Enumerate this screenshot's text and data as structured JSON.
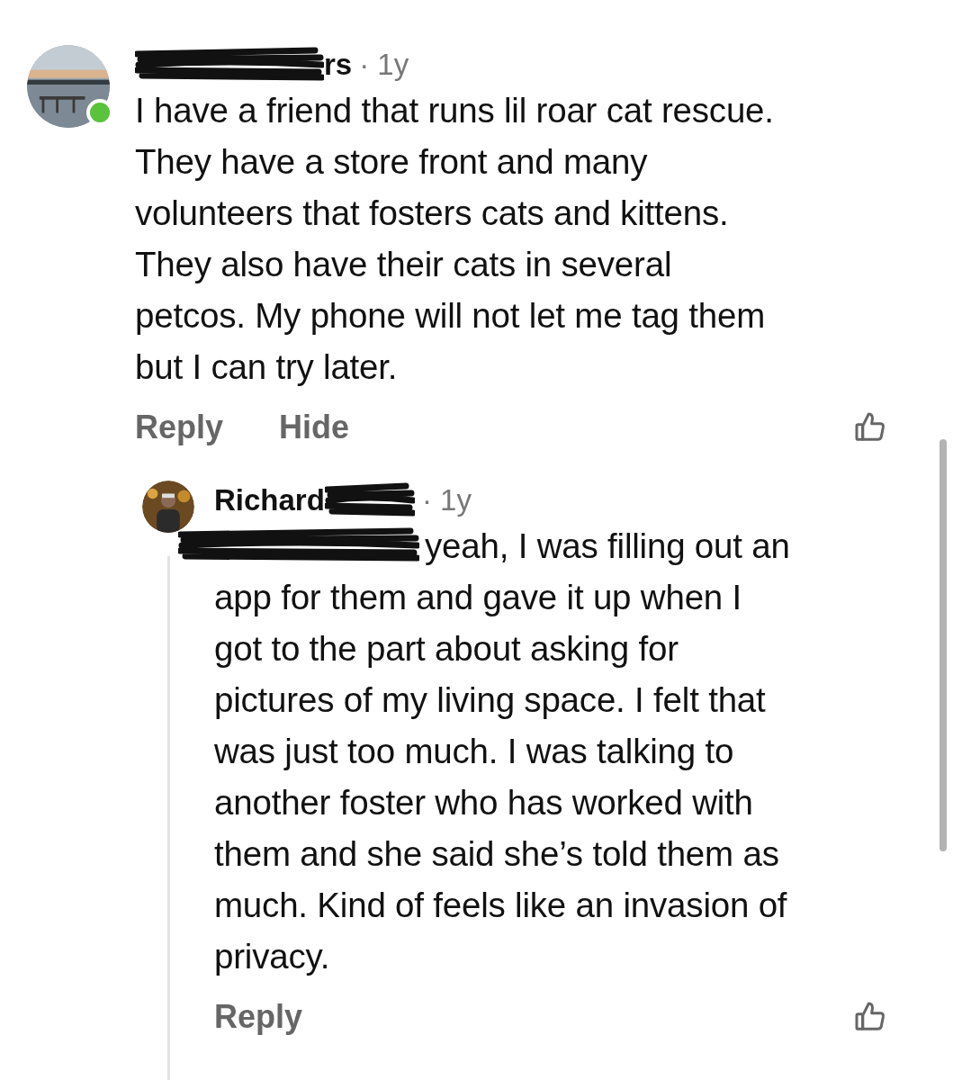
{
  "comments": [
    {
      "author_visible": "rs",
      "author_redacted": true,
      "time": "· 1y",
      "online": true,
      "lines": [
        "I have a friend that runs lil roar cat rescue.",
        "They have a store front and many",
        "volunteers that fosters cats and kittens.",
        "They also have their cats in several",
        "petcos. My phone will not let me tag them",
        "but I can try later."
      ],
      "actions": [
        "Reply",
        "Hide"
      ],
      "mention_redacted": false
    },
    {
      "author_visible": "Richard",
      "author_redacted": true,
      "time": "· 1y",
      "online": false,
      "mention_redacted": true,
      "lines": [
        "yeah, I was filling out an",
        "app for them and gave it up when I",
        "got to the part about asking for",
        "pictures of my living space. I felt that",
        "was just too much. I was talking to",
        "another foster who has worked with",
        "them and she said she’s told them as",
        "much. Kind of feels like an invasion of",
        "privacy."
      ],
      "actions": [
        "Reply"
      ]
    }
  ]
}
